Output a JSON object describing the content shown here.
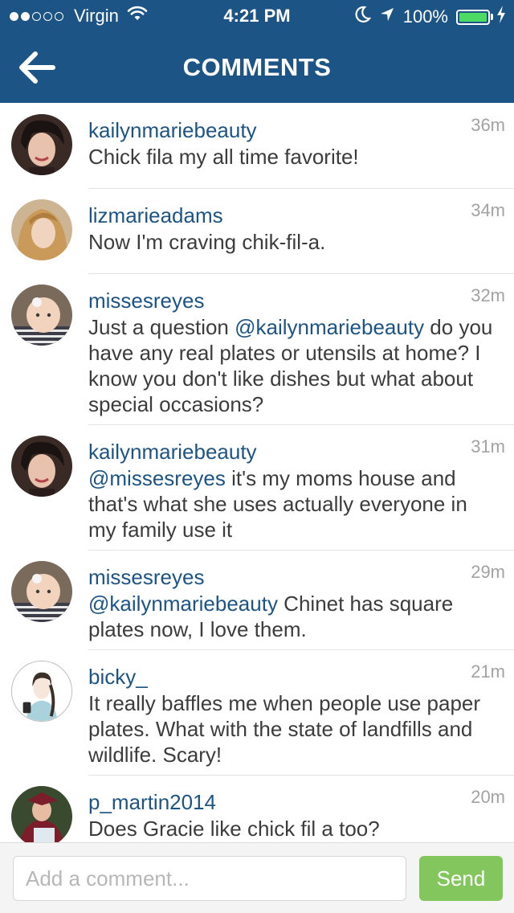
{
  "status_bar": {
    "carrier": "Virgin",
    "time": "4:21 PM",
    "battery": "100%",
    "signal_dots_on": 2,
    "signal_dots_total": 5,
    "battery_level": 1.0
  },
  "nav": {
    "title": "COMMENTS",
    "back_icon": "arrow-left-icon"
  },
  "colors": {
    "nav_bg": "#1c5585",
    "username": "#1c5585",
    "send_button": "#71bf45",
    "battery_fill": "#4cd964"
  },
  "comments": [
    {
      "username": "kailynmariebeauty",
      "time": "36m",
      "mention": "",
      "text": "Chick fila my all time favorite!",
      "avatar": "dark-hair-woman"
    },
    {
      "username": "lizmarieadams",
      "time": "34m",
      "mention": "",
      "text": "Now I'm craving chik-fil-a.",
      "avatar": "blonde-woman"
    },
    {
      "username": "missesreyes",
      "time": "32m",
      "pre": "Just a question ",
      "mention": "@kailynmariebeauty",
      "text": " do you have any real plates or utensils at home? I know you don't like dishes but what about special occasions?",
      "avatar": "baby"
    },
    {
      "username": "kailynmariebeauty",
      "time": "31m",
      "mention": "@missesreyes",
      "text": " it's my moms house and that's what she uses actually everyone in my family use it",
      "avatar": "dark-hair-woman"
    },
    {
      "username": "missesreyes",
      "time": "29m",
      "mention": "@kailynmariebeauty",
      "text": " Chinet has square plates now, I love them.",
      "avatar": "baby"
    },
    {
      "username": "bicky_",
      "time": "21m",
      "mention": "",
      "text": "It really baffles me when people use paper plates. What with the state of landfills and wildlife. Scary!",
      "avatar": "illustration-girl"
    },
    {
      "username": "p_martin2014",
      "time": "20m",
      "mention": "",
      "text": "Does Gracie like chick fil a too?",
      "avatar": "graduate"
    }
  ],
  "composer": {
    "placeholder": "Add a comment...",
    "value": "",
    "send_label": "Send"
  }
}
